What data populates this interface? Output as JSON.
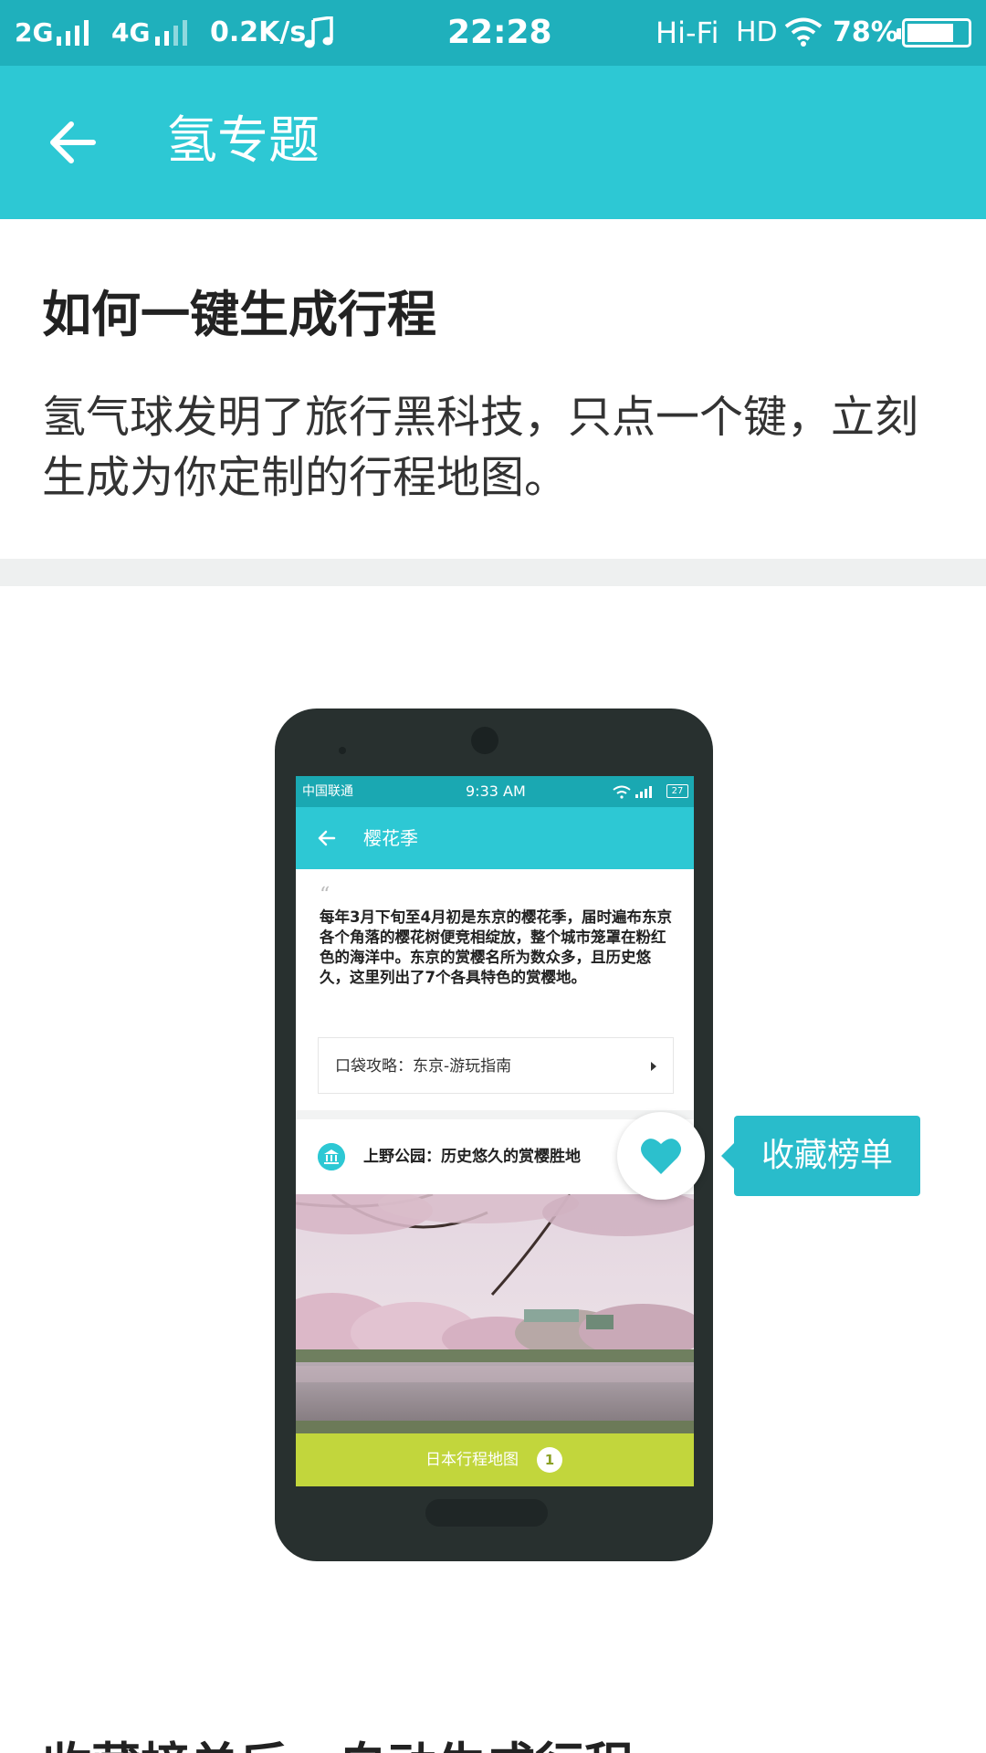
{
  "status_bar": {
    "network1": "2G",
    "network2": "4G",
    "speed": "0.2K/s",
    "time": "22:28",
    "hifi": "Hi-Fi",
    "hd": "HD",
    "battery_percent": "78%",
    "battery_level": 0.78,
    "icons": [
      "signal-icon",
      "music-note-icon",
      "wifi-icon",
      "battery-icon"
    ]
  },
  "app_bar": {
    "back_icon": "back-arrow-icon",
    "title": "氢专题"
  },
  "article": {
    "title": "如何一键生成行程",
    "description": "氢气球发明了旅行黑科技，只点一个键，立刻生成为你定制的行程地图。",
    "next_heading": "收藏榜单后，自动生成行程"
  },
  "illustration": {
    "phone_status": {
      "carrier": "中国联通",
      "time": "9:33 AM",
      "battery": "27"
    },
    "screen_title": "樱花季",
    "quote_mark": "“",
    "intro_text": "每年3月下旬至4月初是东京的樱花季，届时遍布东京各个角落的樱花树便竞相绽放，整个城市笼罩在粉红色的海洋中。东京的赏樱名所为数众多，且历史悠久，这里列出了7个各具特色的赏樱地。",
    "guide_card": "口袋攻略：东京-游玩指南",
    "place_item": "上野公园：历史悠久的赏樱胜地",
    "bottom_bar": "日本行程地图",
    "bottom_badge": "1",
    "callout": "收藏榜单",
    "heart_icon": "heart-icon"
  },
  "colors": {
    "status_bar": "#1fb0bc",
    "app_bar": "#2dc8d4",
    "callout": "#29bccb",
    "bottom_bar": "#c2d63c",
    "phone_body": "#28302f",
    "divider": "#eef0f0"
  }
}
